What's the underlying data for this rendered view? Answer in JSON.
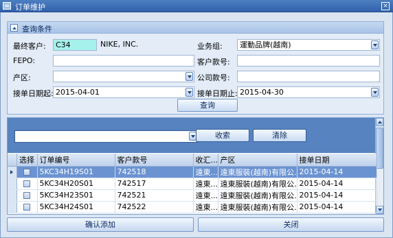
{
  "window": {
    "title": "订单维护",
    "close_glyph": "×"
  },
  "query_panel": {
    "title": "查询条件",
    "final_customer_label": "最终客户:",
    "final_customer_code": "C34",
    "final_customer_name": "NIKE, INC.",
    "business_group_label": "业务组:",
    "business_group_value": "運動品牌(越南)",
    "fepo_label": "FEPO:",
    "fepo_value": "",
    "customer_style_label": "客户款号:",
    "customer_style_value": "",
    "production_area_label": "产区:",
    "production_area_value": "",
    "company_style_label": "公司款号:",
    "company_style_value": "",
    "order_date_from_label": "接单日期起:",
    "order_date_from": "2015-04-01",
    "order_date_to_label": "接单日期止:",
    "order_date_to": "2015-04-30",
    "query_button": "查询"
  },
  "grid_toolbar": {
    "filter_value": "",
    "collapse_button": "收索",
    "clear_button": "清除"
  },
  "grid": {
    "columns": [
      "选择",
      "订单编号",
      "客户款号",
      "收汇...",
      "产区",
      "接单日期"
    ],
    "rows": [
      {
        "order_no": "5KC34H19S01",
        "customer_style": "742518",
        "receipt": "遠東...",
        "area": "遠東服裝(越南)有限公...",
        "date": "2015-04-14"
      },
      {
        "order_no": "5KC34H20S01",
        "customer_style": "742517",
        "receipt": "遠東...",
        "area": "遠東服裝(越南)有限公...",
        "date": "2015-04-14"
      },
      {
        "order_no": "5KC34H23S01",
        "customer_style": "742521",
        "receipt": "遠東...",
        "area": "遠東服裝(越南)有限公...",
        "date": "2015-04-14"
      },
      {
        "order_no": "5KC34H24S01",
        "customer_style": "742522",
        "receipt": "遠東...",
        "area": "遠東服裝(越南)有限公...",
        "date": "2015-04-14"
      }
    ]
  },
  "footer": {
    "confirm_button": "确认添加",
    "close_button": "关闭"
  },
  "icons": {
    "window_icon": "app-window-icon",
    "toggle": "collapse-icon",
    "dropdown": "chevron-down-icon",
    "row_indicator": "current-row-pointer-icon"
  },
  "colors": {
    "title_bar": "#3262ab",
    "selected_row": "#6b93d1",
    "toolbar": "#5783c0",
    "customer_code_bg": "#a7f1ec"
  }
}
